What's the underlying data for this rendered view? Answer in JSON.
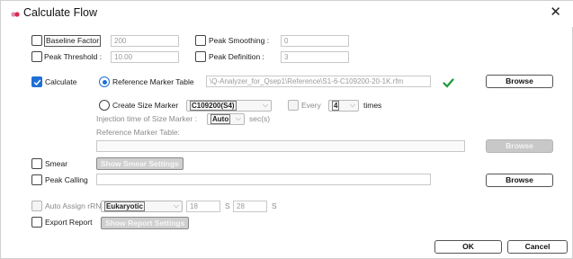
{
  "window": {
    "title": "Calculate Flow",
    "close_glyph": "✕"
  },
  "baseline_factor": {
    "label": "Baseline Factor",
    "value": "200",
    "checked": false
  },
  "peak_smoothing": {
    "label": "Peak Smoothing :",
    "value": "0",
    "checked": false
  },
  "peak_threshold": {
    "label": "Peak Threshold :",
    "value": "10.00",
    "checked": false
  },
  "peak_definition": {
    "label": "Peak Definition :",
    "value": "3",
    "checked": false
  },
  "calculate": {
    "label": "Calculate",
    "checked": true,
    "reference_marker_table": {
      "label": "Reference Marker Table",
      "path": "\\Q-Analyzer_for_Qsep1\\Reference\\S1-6-C109200-20-1K.rfm",
      "selected": true,
      "status_icon": "green-checkmark-icon"
    },
    "browse_label": "Browse",
    "create_size_marker": {
      "label": "Create Size Marker",
      "option": "C109200(S4)",
      "selected": false
    },
    "every": {
      "label": "Every",
      "value": "4",
      "suffix": "times"
    },
    "injection_time": {
      "label": "Injection time of Size Marker :",
      "value": "Auto",
      "unit": "sec(s)"
    },
    "ref_table_label": "Reference Marker Table:",
    "browse2_label": "Browse"
  },
  "smear": {
    "label": "Smear",
    "button": "Show Smear Settings"
  },
  "peak_calling": {
    "label": "Peak Calling",
    "browse_label": "Browse"
  },
  "auto_assign": {
    "label": "Auto Assign rRNA",
    "option": "Eukaryotic",
    "value1": "18",
    "unit1": "S",
    "value2": "28",
    "unit2": "S"
  },
  "export_report": {
    "label": "Export Report",
    "button": "Show Report Settings"
  },
  "footer": {
    "ok_label": "OK",
    "cancel_label": "Cancel"
  },
  "colors": {
    "accent": "#1e6fd6",
    "check_green": "#1a9a3c"
  }
}
